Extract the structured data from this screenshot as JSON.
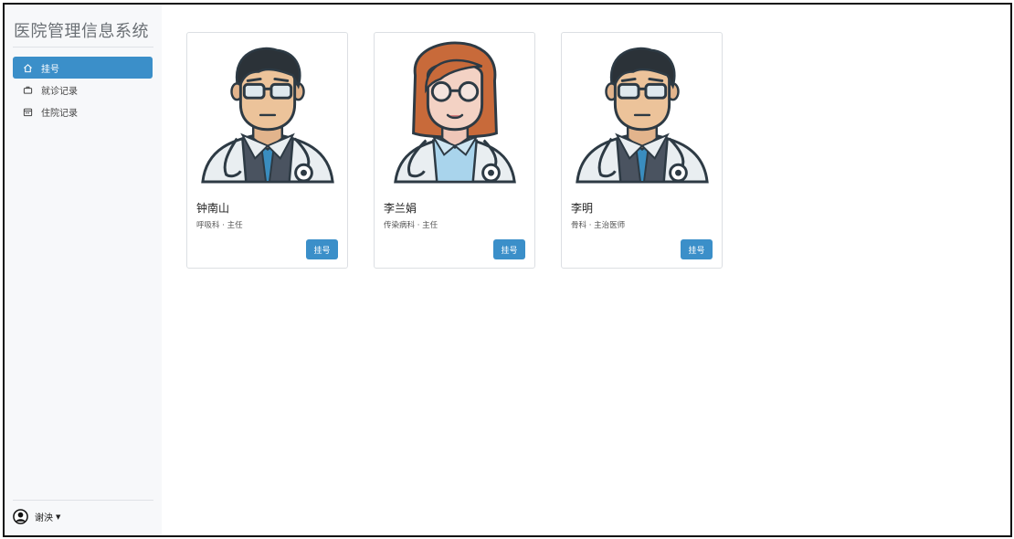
{
  "app": {
    "title": "医院管理信息系统"
  },
  "sidebar": {
    "items": [
      {
        "label": "挂号",
        "icon": "home-icon",
        "active": true
      },
      {
        "label": "就诊记录",
        "icon": "briefcase-icon",
        "active": false
      },
      {
        "label": "住院记录",
        "icon": "calendar-icon",
        "active": false
      }
    ]
  },
  "user": {
    "name": "谢泱",
    "icon": "user-avatar-icon"
  },
  "doctors": [
    {
      "name": "钟南山",
      "title": "呼吸科 · 主任",
      "button": "挂号",
      "avatar": "male-doctor-avatar"
    },
    {
      "name": "李兰娟",
      "title": "传染病科 · 主任",
      "button": "挂号",
      "avatar": "female-doctor-avatar"
    },
    {
      "name": "李明",
      "title": "骨科 · 主治医师",
      "button": "挂号",
      "avatar": "male-doctor-avatar"
    }
  ],
  "colors": {
    "accent": "#3b8fc9",
    "sidebar_bg": "#f7f8fa",
    "card_border": "#dcdfe3"
  }
}
